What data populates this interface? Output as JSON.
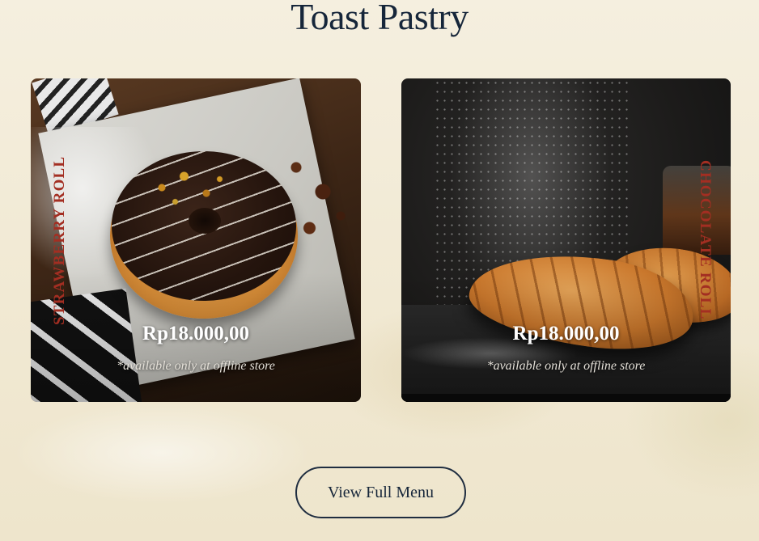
{
  "section": {
    "title": "Toast Pastry"
  },
  "products": [
    {
      "name": "STRAWBERRY ROLL",
      "price": "Rp18.000,00",
      "note": "*available only at offline store"
    },
    {
      "name": "CHOCOLATE ROLL",
      "price": "Rp18.000,00",
      "note": "*available only at offline store"
    }
  ],
  "cta": {
    "label": "View Full Menu"
  },
  "colors": {
    "background": "#f3ecd9",
    "title": "#16263a",
    "product_name": "#a32e22",
    "button_border": "#1f2d40"
  }
}
